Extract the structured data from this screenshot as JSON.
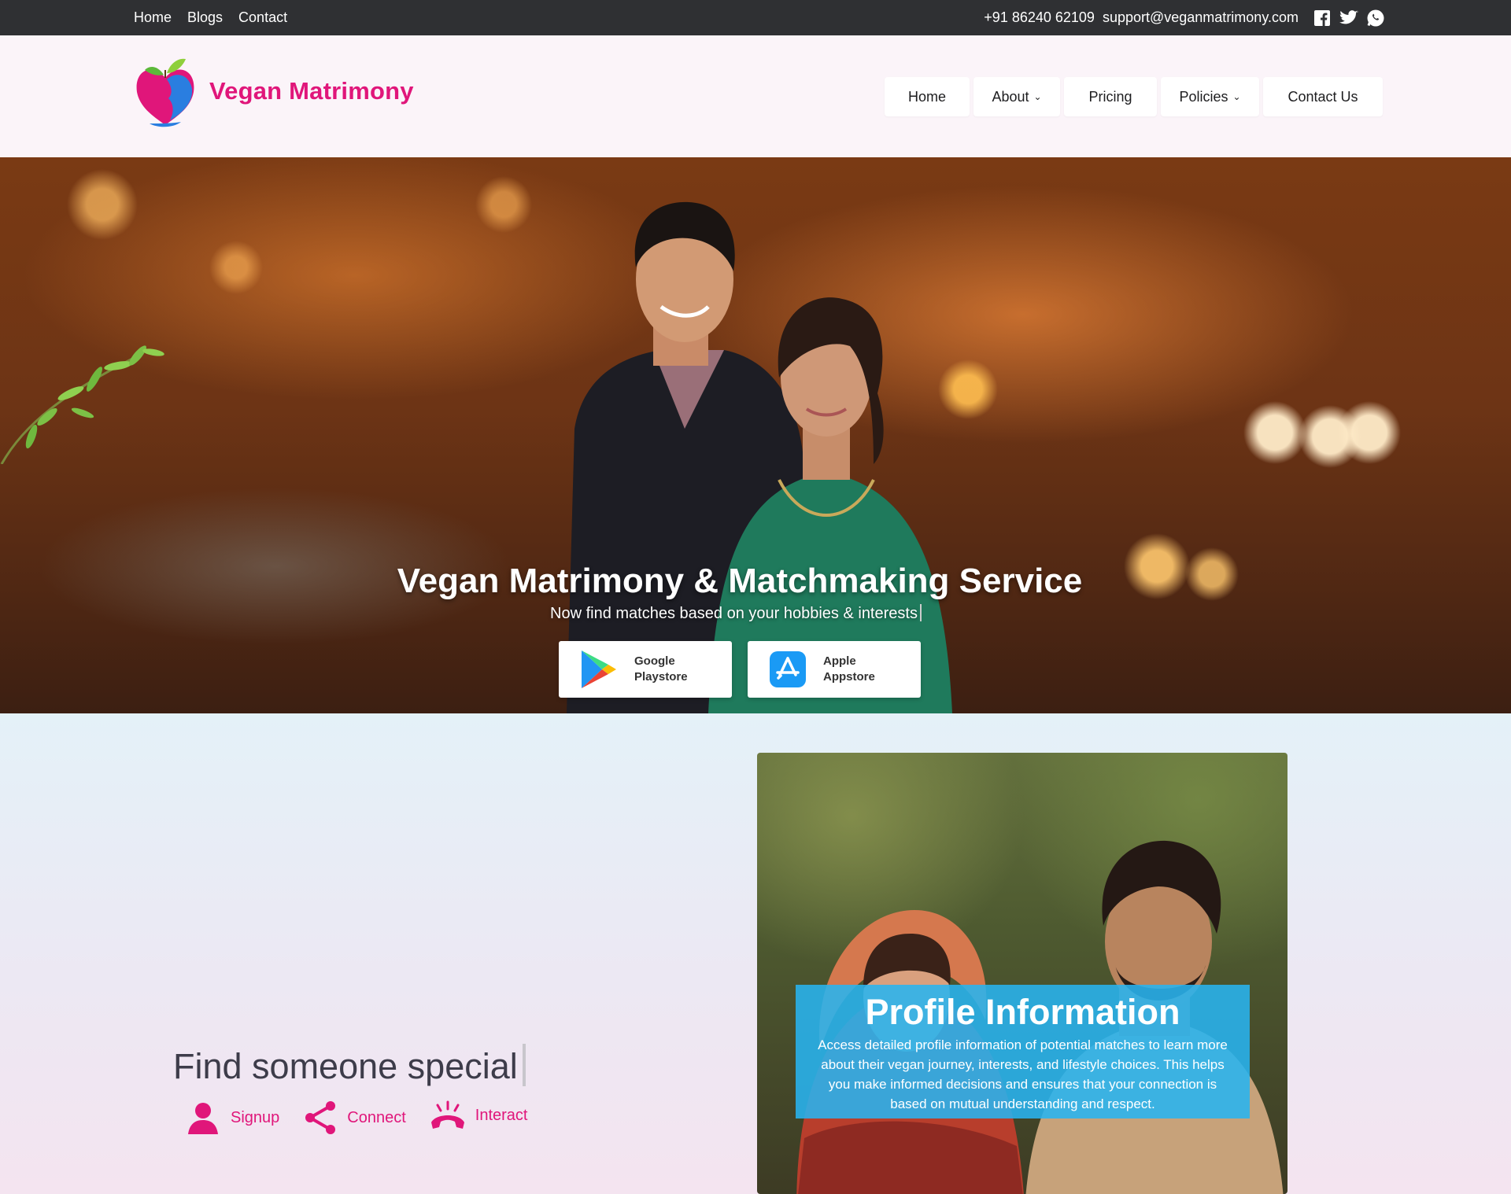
{
  "topbar": {
    "links": [
      "Home",
      "Blogs",
      "Contact"
    ],
    "phone": "+91 86240 62109",
    "email": "support@veganmatrimony.com",
    "social_icons": [
      "facebook-icon",
      "twitter-icon",
      "whatsapp-icon"
    ]
  },
  "header": {
    "brand": "Vegan Matrimony",
    "nav": [
      {
        "label": "Home",
        "dropdown": false
      },
      {
        "label": "About",
        "dropdown": true
      },
      {
        "label": "Pricing",
        "dropdown": false
      },
      {
        "label": "Policies",
        "dropdown": true
      },
      {
        "label": "Contact Us",
        "dropdown": false
      }
    ]
  },
  "hero": {
    "title": "Vegan Matrimony & Matchmaking Service",
    "subtitle": "Now find matches based on your hobbies & interests",
    "stores": [
      {
        "line1": "Google",
        "line2": "Playstore",
        "icon": "google-play-icon"
      },
      {
        "line1": "Apple",
        "line2": "Appstore",
        "icon": "app-store-icon"
      }
    ]
  },
  "lower": {
    "heading": "Find someone special",
    "steps": [
      {
        "label": "Signup",
        "icon": "user-icon"
      },
      {
        "label": "Connect",
        "icon": "share-icon"
      },
      {
        "label": "Interact",
        "icon": "phone-ringing-icon"
      }
    ],
    "card": {
      "title": "Profile Information",
      "text": "Access detailed profile information of potential matches to learn more about their vegan journey, interests, and lifestyle choices. This helps you make informed decisions and ensures that your connection is based on mutual understanding and respect."
    }
  },
  "colors": {
    "brand_pink": "#e0167a",
    "topbar_bg": "#2f3033",
    "info_box_blue": "#28b4f0"
  }
}
